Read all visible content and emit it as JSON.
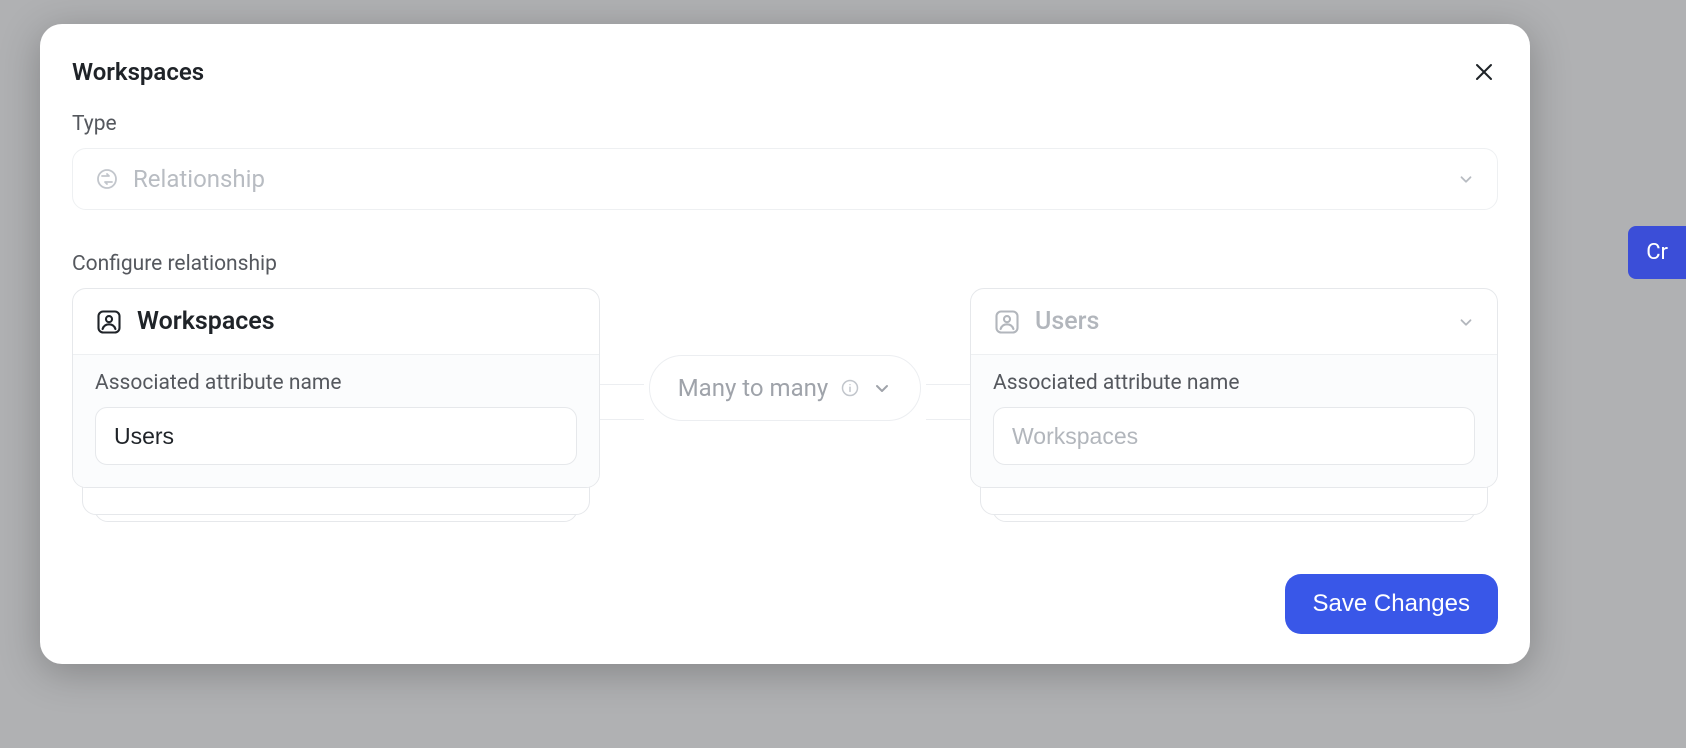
{
  "background": {
    "partial_button": "Cr"
  },
  "modal": {
    "title": "Workspaces",
    "type_section": {
      "label": "Type",
      "value": "Relationship"
    },
    "configure": {
      "label": "Configure relationship",
      "left_entity": {
        "name": "Workspaces",
        "assoc_label": "Associated attribute name",
        "assoc_value": "Users"
      },
      "cardinality": {
        "label": "Many to many"
      },
      "right_entity": {
        "name": "Users",
        "assoc_label": "Associated attribute name",
        "assoc_placeholder": "Workspaces",
        "assoc_value": ""
      }
    },
    "save_label": "Save Changes"
  }
}
